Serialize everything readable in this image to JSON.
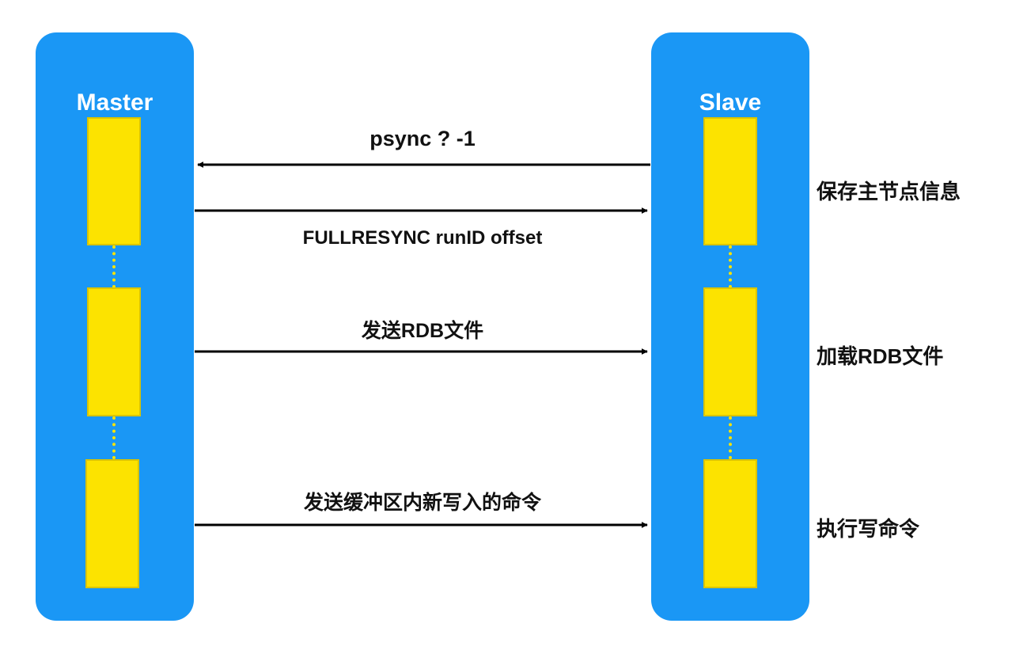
{
  "master": {
    "title": "Master"
  },
  "slave": {
    "title": "Slave"
  },
  "messages": [
    {
      "label": "psync ? -1",
      "direction": "slave-to-master"
    },
    {
      "label": "FULLRESYNC runID offset",
      "direction": "master-to-slave"
    },
    {
      "label": "发送RDB文件",
      "direction": "master-to-slave"
    },
    {
      "label": "发送缓冲区内新写入的命令",
      "direction": "master-to-slave"
    }
  ],
  "slave_notes": [
    {
      "label": "保存主节点信息"
    },
    {
      "label": "加载RDB文件"
    },
    {
      "label": "执行写命令"
    }
  ],
  "colors": {
    "lifeline": "#1a97f5",
    "activation": "#fce300",
    "arrow": "#000000"
  }
}
